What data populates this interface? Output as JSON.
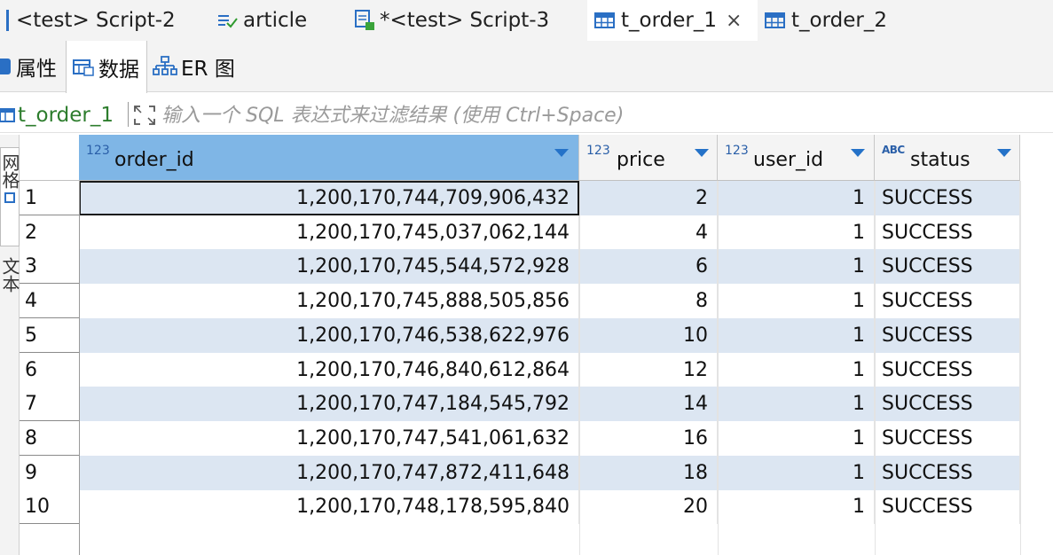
{
  "editor_tabs": [
    {
      "label": "<test> Script-2",
      "icon": "sql-script-icon"
    },
    {
      "label": "article",
      "icon": "table-view-icon"
    },
    {
      "label": "*<test> Script-3",
      "icon": "sql-script-modified-icon"
    },
    {
      "label": "t_order_1",
      "icon": "table-icon",
      "active": true,
      "close": "×"
    },
    {
      "label": "t_order_2",
      "icon": "table-icon"
    }
  ],
  "sub_tabs": [
    {
      "label": "属性",
      "icon": "properties-icon"
    },
    {
      "label": "数据",
      "icon": "data-grid-icon",
      "active": true
    },
    {
      "label": "ER 图",
      "icon": "er-diagram-icon"
    }
  ],
  "filter": {
    "table_name": "t_order_1",
    "placeholder": "输入一个 SQL 表达式来过滤结果 (使用 Ctrl+Space)"
  },
  "left_vertical_tabs": [
    "网格",
    "文本"
  ],
  "columns": [
    {
      "name": "order_id",
      "type_badge": "123",
      "selected": true
    },
    {
      "name": "price",
      "type_badge": "123"
    },
    {
      "name": "user_id",
      "type_badge": "123"
    },
    {
      "name": "status",
      "type_badge": "ABC"
    }
  ],
  "rows": [
    {
      "n": "1",
      "order_id": "1,200,170,744,709,906,432",
      "price": "2",
      "user_id": "1",
      "status": "SUCCESS"
    },
    {
      "n": "2",
      "order_id": "1,200,170,745,037,062,144",
      "price": "4",
      "user_id": "1",
      "status": "SUCCESS"
    },
    {
      "n": "3",
      "order_id": "1,200,170,745,544,572,928",
      "price": "6",
      "user_id": "1",
      "status": "SUCCESS"
    },
    {
      "n": "4",
      "order_id": "1,200,170,745,888,505,856",
      "price": "8",
      "user_id": "1",
      "status": "SUCCESS"
    },
    {
      "n": "5",
      "order_id": "1,200,170,746,538,622,976",
      "price": "10",
      "user_id": "1",
      "status": "SUCCESS"
    },
    {
      "n": "6",
      "order_id": "1,200,170,746,840,612,864",
      "price": "12",
      "user_id": "1",
      "status": "SUCCESS"
    },
    {
      "n": "7",
      "order_id": "1,200,170,747,184,545,792",
      "price": "14",
      "user_id": "1",
      "status": "SUCCESS"
    },
    {
      "n": "8",
      "order_id": "1,200,170,747,541,061,632",
      "price": "16",
      "user_id": "1",
      "status": "SUCCESS"
    },
    {
      "n": "9",
      "order_id": "1,200,170,747,872,411,648",
      "price": "18",
      "user_id": "1",
      "status": "SUCCESS"
    },
    {
      "n": "10",
      "order_id": "1,200,170,748,178,595,840",
      "price": "20",
      "user_id": "1",
      "status": "SUCCESS"
    }
  ],
  "colors": {
    "selected_header": "#7fb6e6",
    "row_stripe": "#dce6f2",
    "accent_blue": "#2472c8",
    "table_name_green": "#2d7d2d"
  }
}
